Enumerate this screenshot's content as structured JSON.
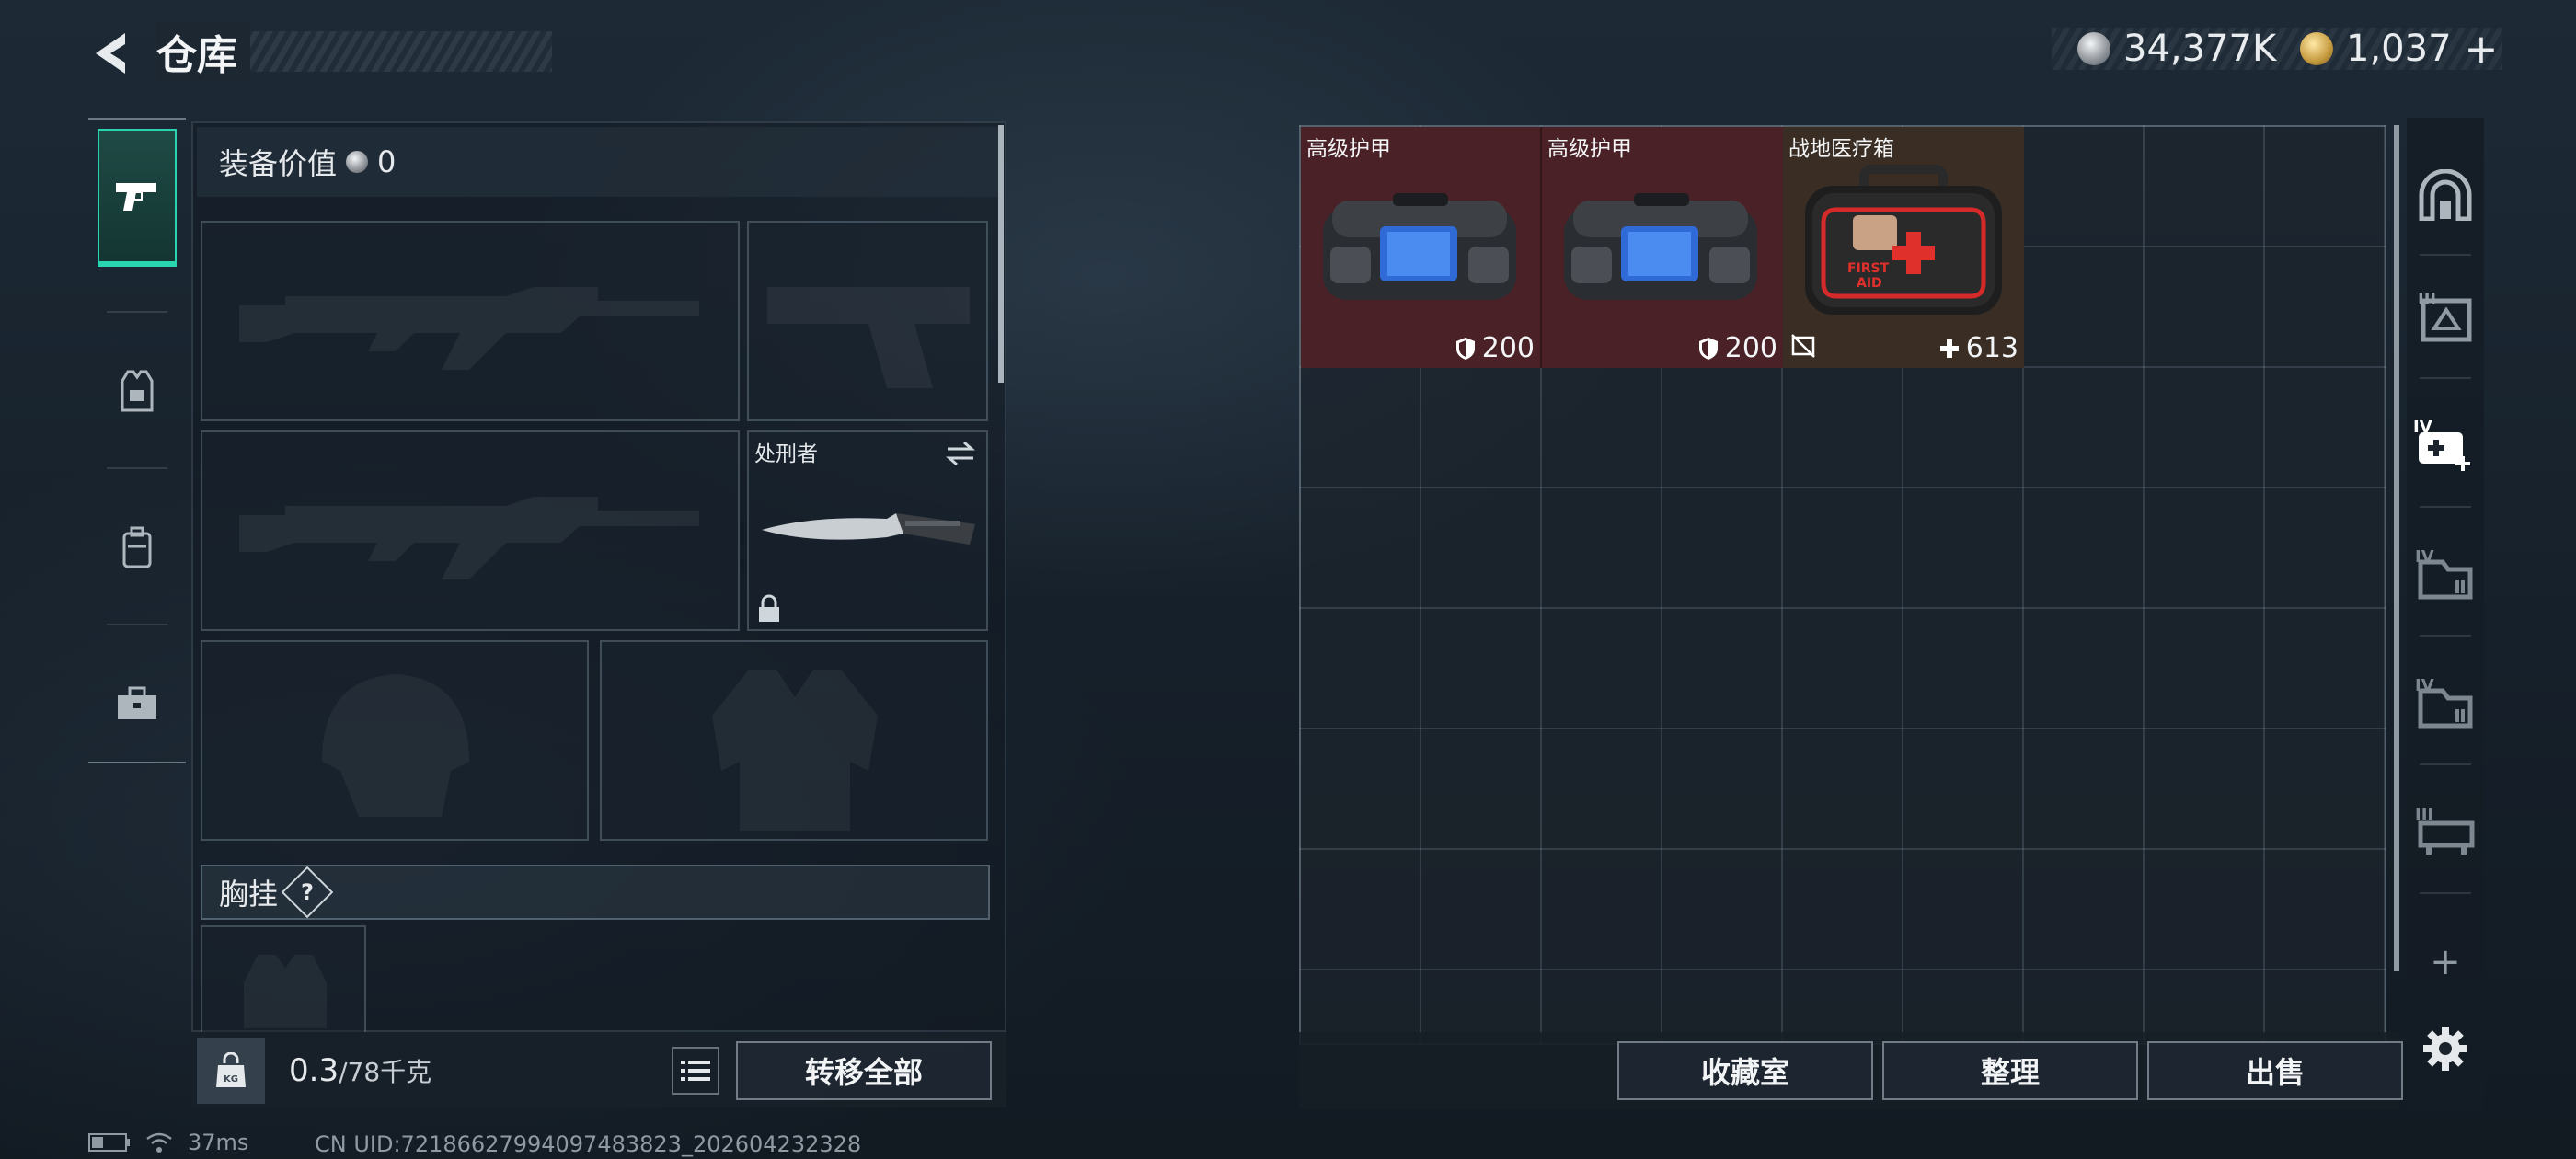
{
  "header": {
    "title": "仓库",
    "currency_silver": "34,377K",
    "currency_gold": "1,037",
    "gold_add": "+"
  },
  "loadout": {
    "value_label": "装备价值",
    "value": "0",
    "melee_name": "处刑者",
    "chest_rig_label": "胸挂",
    "chest_rig_help": "?",
    "weight_current": "0.3",
    "weight_max": "/78千克",
    "transfer_all": "转移全部"
  },
  "stash": {
    "items": [
      {
        "name": "高级护甲",
        "stat": "200",
        "stat_icon": "shield-icon",
        "bg": "#4a2127"
      },
      {
        "name": "高级护甲",
        "stat": "200",
        "stat_icon": "shield-icon",
        "bg": "#4a2127"
      },
      {
        "name": "战地医疗箱",
        "stat": "613",
        "stat_icon": "plus-icon",
        "bg": "#3a2e24"
      }
    ],
    "buttons": {
      "collection": "收藏室",
      "organize": "整理",
      "sell": "出售"
    },
    "add_tab": "+"
  },
  "status": {
    "ping": "37ms",
    "uid": "CN UID:7218662799409748​3823_202604232328"
  },
  "colors": {
    "active_tab": "#2bd4b0",
    "armor_bg": "#4a2127",
    "medkit_bg": "#3a2e24"
  }
}
